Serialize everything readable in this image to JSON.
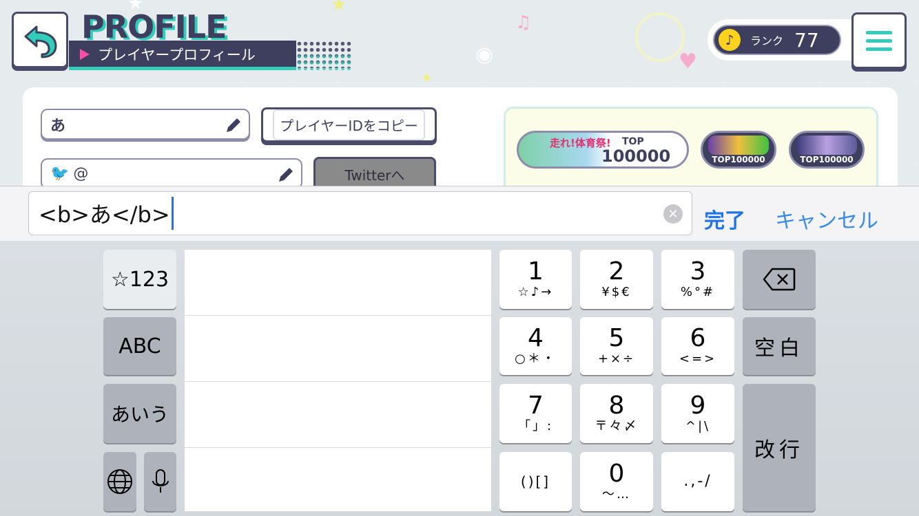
{
  "header": {
    "title": "PROFILE",
    "subtitle": "プレイヤープロフィール"
  },
  "rank": {
    "label": "ランク",
    "value": "77"
  },
  "profile": {
    "name_value": "あ",
    "copy_id_label": "プレイヤーIDをコピー",
    "twitter_prefix": "@",
    "twitter_button_label": "Twitterへ"
  },
  "badges": {
    "badge1_title": "走れ!体育祭!",
    "badge1_rank_label": "TOP",
    "badge1_rank_value": "100000",
    "badge2_caption": "TOP100000",
    "badge3_caption": "TOP100000"
  },
  "input": {
    "value": "<b>あ</b>",
    "done_label": "完了",
    "cancel_label": "キャンセル"
  },
  "keyboard": {
    "mode_symbols": "☆123",
    "mode_abc": "ABC",
    "mode_kana": "あいう",
    "key1_main": "1",
    "key1_sub": "☆♪→",
    "key2_main": "2",
    "key2_sub": "¥$€",
    "key3_main": "3",
    "key3_sub": "%°#",
    "key4_main": "4",
    "key4_sub": "○＊・",
    "key5_main": "5",
    "key5_sub": "+×÷",
    "key6_main": "6",
    "key6_sub": "<=>",
    "key7_main": "7",
    "key7_sub": "「」:",
    "key8_main": "8",
    "key8_sub": "〒々〆",
    "key9_main": "9",
    "key9_sub": "^|\\",
    "key0_main": "0",
    "key0_sub": "〜…",
    "key_brackets": "()[]",
    "key_punct": ".,-/",
    "space_label": "空白",
    "return_label": "改行"
  },
  "colors": {
    "accent_teal": "#33ccbb",
    "navy": "#3e3e5e",
    "ios_blue": "#1f74e8"
  }
}
